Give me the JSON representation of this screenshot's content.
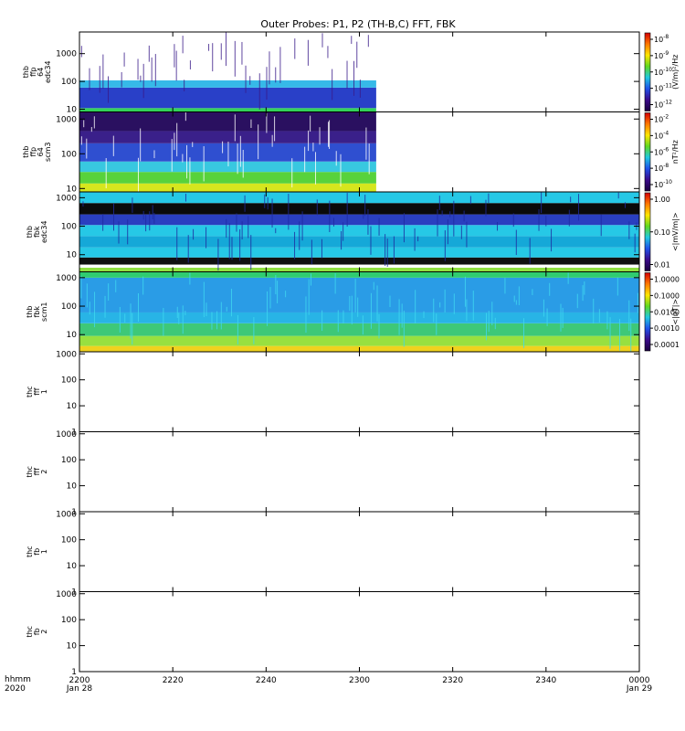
{
  "title": "Outer Probes: P1, P2 (TH-B,C) FFT, FBK",
  "time_axis": {
    "ticks": [
      "2200",
      "2220",
      "2240",
      "2300",
      "2320",
      "2340",
      "0000"
    ],
    "start_label": "Jan 28",
    "end_label": "Jan 29",
    "unit_label": "hhmm",
    "year_label": "2020"
  },
  "chart_data": [
    {
      "type": "heatmap",
      "panel": "thb ffp 64 edc34",
      "ylabel": [
        "thb",
        "ffp",
        "64",
        "edc34"
      ],
      "y_ticks": [
        "1000",
        "100",
        "10"
      ],
      "y_scale": "log",
      "ylim": [
        8,
        6000
      ],
      "data_extent": [
        0,
        0.53
      ],
      "colorbar": {
        "label": "(V/m)²/Hz",
        "ticks": [
          {
            "m": "10",
            "e": "-8"
          },
          {
            "m": "10",
            "e": "-9"
          },
          {
            "m": "10",
            "e": "-10"
          },
          {
            "m": "10",
            "e": "-11"
          },
          {
            "m": "10",
            "e": "-12"
          }
        ]
      },
      "bands": [
        {
          "from": 8,
          "to": 11,
          "color": "#33d25a"
        },
        {
          "from": 11,
          "to": 60,
          "color": "#2940c8"
        },
        {
          "from": 60,
          "to": 110,
          "color": "#36b9e8"
        },
        {
          "from": 110,
          "to": 6000,
          "color": "#ffffff"
        }
      ],
      "spikes": "#3a1a8a"
    },
    {
      "type": "heatmap",
      "panel": "thb ffp 64 scm3",
      "ylabel": [
        "thb",
        "ffp",
        "64",
        "scm3"
      ],
      "y_ticks": [
        "1000",
        "100",
        "10"
      ],
      "y_scale": "log",
      "ylim": [
        8,
        1600
      ],
      "data_extent": [
        0,
        0.53
      ],
      "colorbar": {
        "label": "nT²/Hz",
        "ticks": [
          {
            "m": "10",
            "e": "-2"
          },
          {
            "m": "10",
            "e": "-4"
          },
          {
            "m": "10",
            "e": "-6"
          },
          {
            "m": "10",
            "e": "-8"
          },
          {
            "m": "10",
            "e": "-10"
          }
        ]
      },
      "bands": [
        {
          "from": 8,
          "to": 14,
          "color": "#d6e61e"
        },
        {
          "from": 14,
          "to": 30,
          "color": "#58d23c"
        },
        {
          "from": 30,
          "to": 60,
          "color": "#38c8e0"
        },
        {
          "from": 60,
          "to": 200,
          "color": "#2f4fd0"
        },
        {
          "from": 200,
          "to": 450,
          "color": "#3a208a"
        },
        {
          "from": 450,
          "to": 1600,
          "color": "#2a1060"
        }
      ],
      "spikes": "#ffffff"
    },
    {
      "type": "heatmap",
      "panel": "thb fbk edc34",
      "ylabel": [
        "thb",
        "fbk",
        "edc34"
      ],
      "y_ticks": [
        "1000",
        "100",
        "10"
      ],
      "y_scale": "log",
      "ylim": [
        2.5,
        1600
      ],
      "data_extent": [
        0,
        1
      ],
      "colorbar": {
        "label": "<|mV/m|>",
        "ticks": [
          {
            "m": "1.00",
            "e": ""
          },
          {
            "m": "0.10",
            "e": ""
          },
          {
            "m": "0.01",
            "e": ""
          }
        ]
      },
      "bands": [
        {
          "from": 2.5,
          "to": 3.5,
          "color": "#8fe040"
        },
        {
          "from": 3.5,
          "to": 4.5,
          "color": "#ffffff"
        },
        {
          "from": 4.5,
          "to": 8,
          "color": "#101010"
        },
        {
          "from": 8,
          "to": 18,
          "color": "#26c8e6"
        },
        {
          "from": 18,
          "to": 45,
          "color": "#15a8d8"
        },
        {
          "from": 45,
          "to": 110,
          "color": "#26c8e6"
        },
        {
          "from": 110,
          "to": 260,
          "color": "#2a3fc0"
        },
        {
          "from": 260,
          "to": 650,
          "color": "#0a0a0a"
        },
        {
          "from": 650,
          "to": 1600,
          "color": "#26c8e6"
        }
      ],
      "spikes": "#1e2aa0"
    },
    {
      "type": "heatmap",
      "panel": "thb fbk scm1",
      "ylabel": [
        "thb",
        "fbk",
        "scm1"
      ],
      "y_ticks": [
        "1000",
        "100",
        "10"
      ],
      "y_scale": "log",
      "ylim": [
        2.5,
        1600
      ],
      "data_extent": [
        0,
        1
      ],
      "colorbar": {
        "label": "<|nT|>",
        "ticks": [
          {
            "m": "1.0000",
            "e": ""
          },
          {
            "m": "0.1000",
            "e": ""
          },
          {
            "m": "0.0100",
            "e": ""
          },
          {
            "m": "0.0010",
            "e": ""
          },
          {
            "m": "0.0001",
            "e": ""
          }
        ]
      },
      "bands": [
        {
          "from": 2.5,
          "to": 4,
          "color": "#f0d21e"
        },
        {
          "from": 4,
          "to": 9,
          "color": "#98e040"
        },
        {
          "from": 9,
          "to": 25,
          "color": "#3ec878"
        },
        {
          "from": 25,
          "to": 60,
          "color": "#28b4e6"
        },
        {
          "from": 60,
          "to": 1000,
          "color": "#2a9ce6"
        },
        {
          "from": 1000,
          "to": 1600,
          "color": "#2fcc70"
        }
      ],
      "spikes": "#40d8f0"
    },
    {
      "type": "heatmap",
      "panel": "thc fff 1",
      "ylabel": [
        "thc",
        "fff",
        "1"
      ],
      "y_ticks": [
        "1000",
        "100",
        "10",
        "1"
      ],
      "y_scale": "log",
      "ylim": [
        1,
        1200
      ],
      "data_extent": [
        0,
        0
      ],
      "bands": []
    },
    {
      "type": "heatmap",
      "panel": "thc fff 2",
      "ylabel": [
        "thc",
        "fff",
        "2"
      ],
      "y_ticks": [
        "1000",
        "100",
        "10",
        "1"
      ],
      "y_scale": "log",
      "ylim": [
        1,
        1200
      ],
      "data_extent": [
        0,
        0
      ],
      "bands": []
    },
    {
      "type": "heatmap",
      "panel": "thc fb 1",
      "ylabel": [
        "thc",
        "fb",
        "1"
      ],
      "y_ticks": [
        "1000",
        "100",
        "10",
        "1"
      ],
      "y_scale": "log",
      "ylim": [
        1,
        1200
      ],
      "data_extent": [
        0,
        0
      ],
      "bands": []
    },
    {
      "type": "heatmap",
      "panel": "thc fb 2",
      "ylabel": [
        "thc",
        "fb",
        "2"
      ],
      "y_ticks": [
        "1000",
        "100",
        "10",
        "1"
      ],
      "y_scale": "log",
      "ylim": [
        1,
        1200
      ],
      "data_extent": [
        0,
        0
      ],
      "bands": []
    }
  ]
}
